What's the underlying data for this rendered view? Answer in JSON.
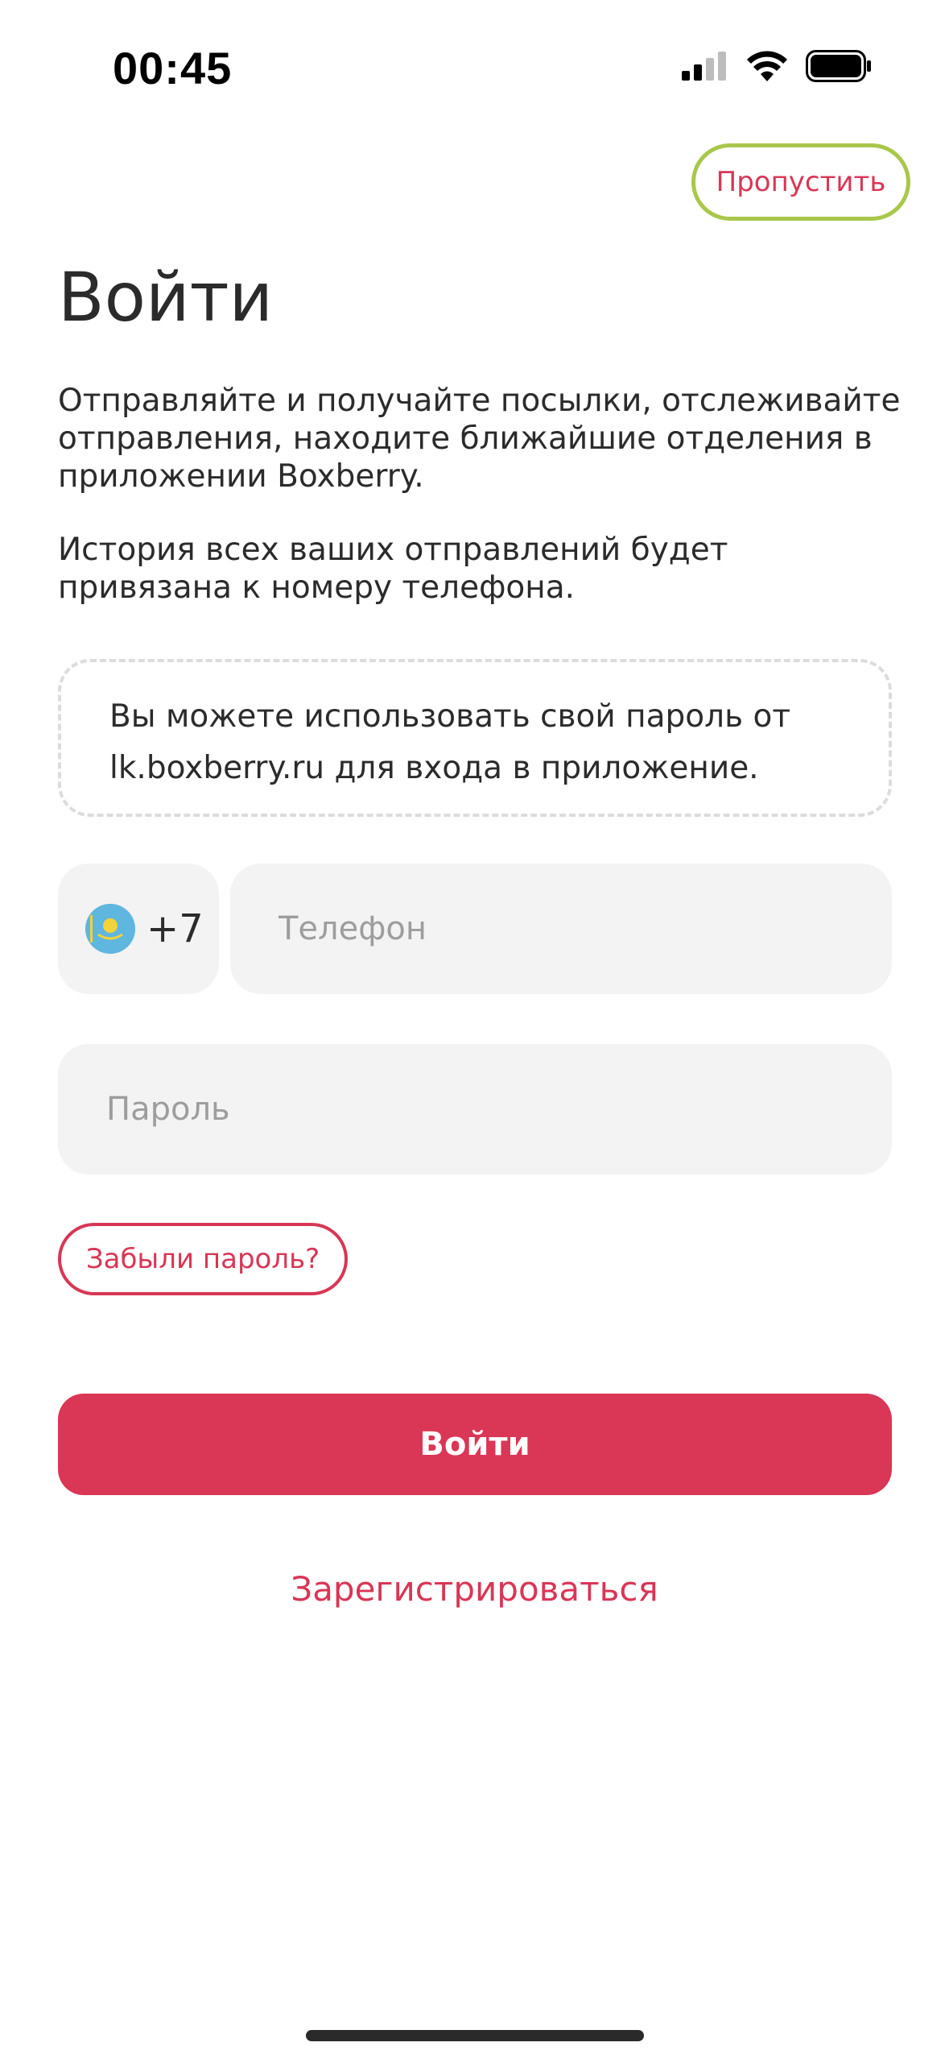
{
  "status_bar": {
    "time": "00:45"
  },
  "header": {
    "skip_label": "Пропустить"
  },
  "title": "Войти",
  "intro": {
    "paragraph1": "Отправляйте и получайте посылки, отслеживайте отправления, находите ближайшие отделения в приложении Boxberry.",
    "paragraph2": "История всех ваших отправлений будет привязана к номеру телефона."
  },
  "info_box": {
    "text": "Вы можете использовать свой пароль от lk.boxberry.ru для входа в приложение."
  },
  "form": {
    "country_code": "+7",
    "country_flag": "kazakhstan-flag-icon",
    "phone_value": "",
    "phone_placeholder": "Телефон",
    "password_value": "",
    "password_placeholder": "Пароль",
    "forgot_label": "Забыли пароль?",
    "login_label": "Войти",
    "register_label": "Зарегистрироваться"
  },
  "colors": {
    "accent": "#da3655",
    "skip_border": "#a9c74a",
    "field_bg": "#f3f3f3"
  }
}
